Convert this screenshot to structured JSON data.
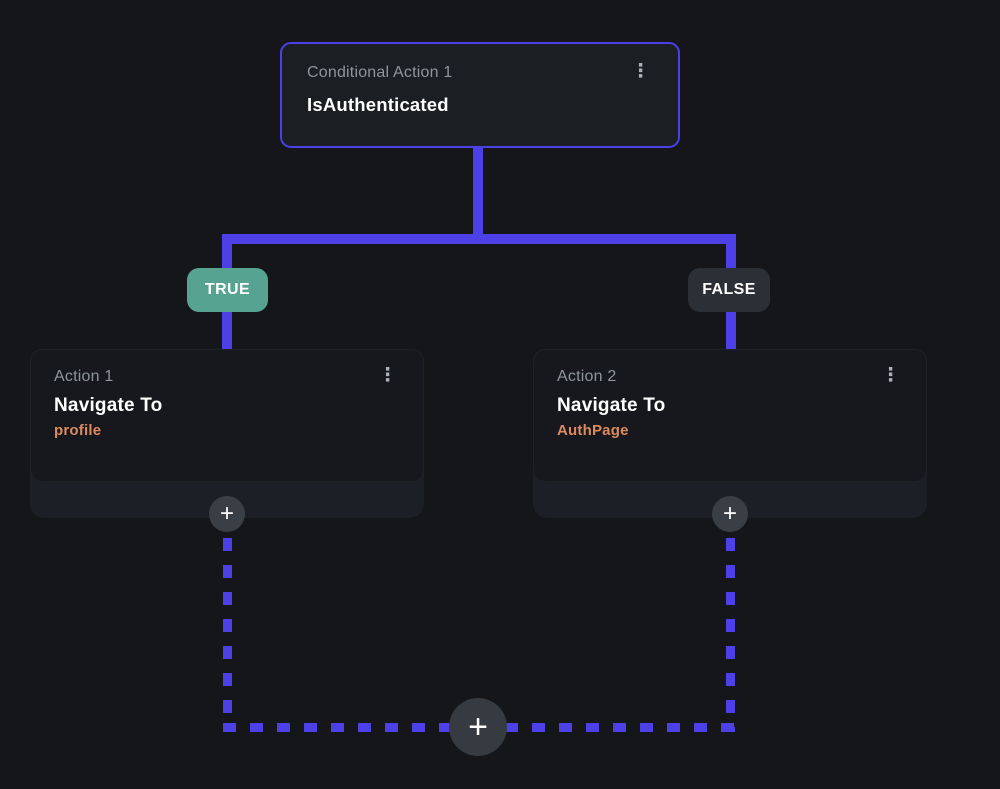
{
  "flow": {
    "condition_node": {
      "label": "Conditional Action 1",
      "value": "IsAuthenticated"
    },
    "true_branch": {
      "badge": "TRUE"
    },
    "false_branch": {
      "badge": "FALSE"
    },
    "action_nodes": [
      {
        "label": "Action 1",
        "action": "Navigate To",
        "target": "profile"
      },
      {
        "label": "Action 2",
        "action": "Navigate To",
        "target": "AuthPage"
      }
    ]
  },
  "icons": {
    "kebab_menu": "⋮",
    "plus": "+"
  },
  "colors": {
    "background": "#141619",
    "connector": "#4C40E6",
    "condition_node_border": "#4C40E6",
    "true_badge_bg": "#57A392",
    "false_badge_bg": "#2B3036",
    "card_bg": "#16181D",
    "card_wrapper_bg": "#1C1F25",
    "target_text": "#DD8A5E",
    "secondary_text": "#8F959C"
  }
}
